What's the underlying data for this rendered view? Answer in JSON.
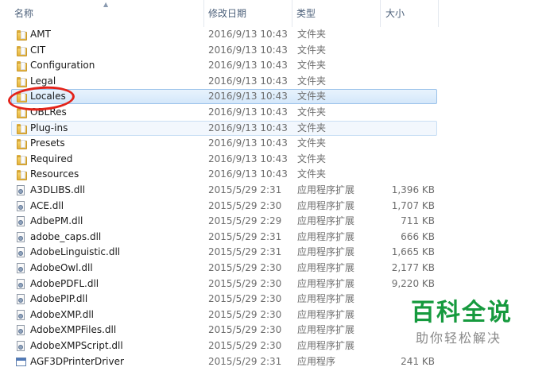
{
  "header": {
    "name": "名称",
    "date": "修改日期",
    "type": "类型",
    "size": "大小",
    "sort_indicator": "up-arrow"
  },
  "files": [
    {
      "name": "AMT",
      "date": "2016/9/13 10:43",
      "type": "文件夹",
      "size": "",
      "icon": "folder-icon"
    },
    {
      "name": "CIT",
      "date": "2016/9/13 10:43",
      "type": "文件夹",
      "size": "",
      "icon": "folder-icon"
    },
    {
      "name": "Configuration",
      "date": "2016/9/13 10:43",
      "type": "文件夹",
      "size": "",
      "icon": "folder-icon"
    },
    {
      "name": "Legal",
      "date": "2016/9/13 10:43",
      "type": "文件夹",
      "size": "",
      "icon": "folder-icon"
    },
    {
      "name": "Locales",
      "date": "2016/9/13 10:43",
      "type": "文件夹",
      "size": "",
      "icon": "folder-icon",
      "state": "selected"
    },
    {
      "name": "OBLRes",
      "date": "2016/9/13 10:43",
      "type": "文件夹",
      "size": "",
      "icon": "folder-icon"
    },
    {
      "name": "Plug-ins",
      "date": "2016/9/13 10:43",
      "type": "文件夹",
      "size": "",
      "icon": "folder-icon",
      "state": "hover"
    },
    {
      "name": "Presets",
      "date": "2016/9/13 10:43",
      "type": "文件夹",
      "size": "",
      "icon": "folder-icon"
    },
    {
      "name": "Required",
      "date": "2016/9/13 10:43",
      "type": "文件夹",
      "size": "",
      "icon": "folder-icon"
    },
    {
      "name": "Resources",
      "date": "2016/9/13 10:43",
      "type": "文件夹",
      "size": "",
      "icon": "folder-icon"
    },
    {
      "name": "A3DLIBS.dll",
      "date": "2015/5/29 2:31",
      "type": "应用程序扩展",
      "size": "1,396 KB",
      "icon": "dll-icon"
    },
    {
      "name": "ACE.dll",
      "date": "2015/5/29 2:30",
      "type": "应用程序扩展",
      "size": "1,707 KB",
      "icon": "dll-icon"
    },
    {
      "name": "AdbePM.dll",
      "date": "2015/5/29 2:29",
      "type": "应用程序扩展",
      "size": "711 KB",
      "icon": "dll-icon"
    },
    {
      "name": "adobe_caps.dll",
      "date": "2015/5/29 2:31",
      "type": "应用程序扩展",
      "size": "666 KB",
      "icon": "dll-icon"
    },
    {
      "name": "AdobeLinguistic.dll",
      "date": "2015/5/29 2:31",
      "type": "应用程序扩展",
      "size": "1,665 KB",
      "icon": "dll-icon"
    },
    {
      "name": "AdobeOwl.dll",
      "date": "2015/5/29 2:30",
      "type": "应用程序扩展",
      "size": "2,177 KB",
      "icon": "dll-icon"
    },
    {
      "name": "AdobePDFL.dll",
      "date": "2015/5/29 2:30",
      "type": "应用程序扩展",
      "size": "9,220 KB",
      "icon": "dll-icon"
    },
    {
      "name": "AdobePIP.dll",
      "date": "2015/5/29 2:30",
      "type": "应用程序扩展",
      "size": "",
      "icon": "dll-icon"
    },
    {
      "name": "AdobeXMP.dll",
      "date": "2015/5/29 2:30",
      "type": "应用程序扩展",
      "size": "",
      "icon": "dll-icon"
    },
    {
      "name": "AdobeXMPFiles.dll",
      "date": "2015/5/29 2:30",
      "type": "应用程序扩展",
      "size": "",
      "icon": "dll-icon"
    },
    {
      "name": "AdobeXMPScript.dll",
      "date": "2015/5/29 2:30",
      "type": "应用程序扩展",
      "size": "",
      "icon": "dll-icon"
    },
    {
      "name": "AGF3DPrinterDriver",
      "date": "2015/5/29 2:31",
      "type": "应用程序",
      "size": "241 KB",
      "icon": "exe-icon"
    }
  ],
  "watermark": {
    "title": "百科全说",
    "subtitle": "助你轻松解决"
  },
  "colors": {
    "selection": "#d4e7fa",
    "annotation_circle": "#e3231a",
    "watermark_green": "#169a3e"
  }
}
